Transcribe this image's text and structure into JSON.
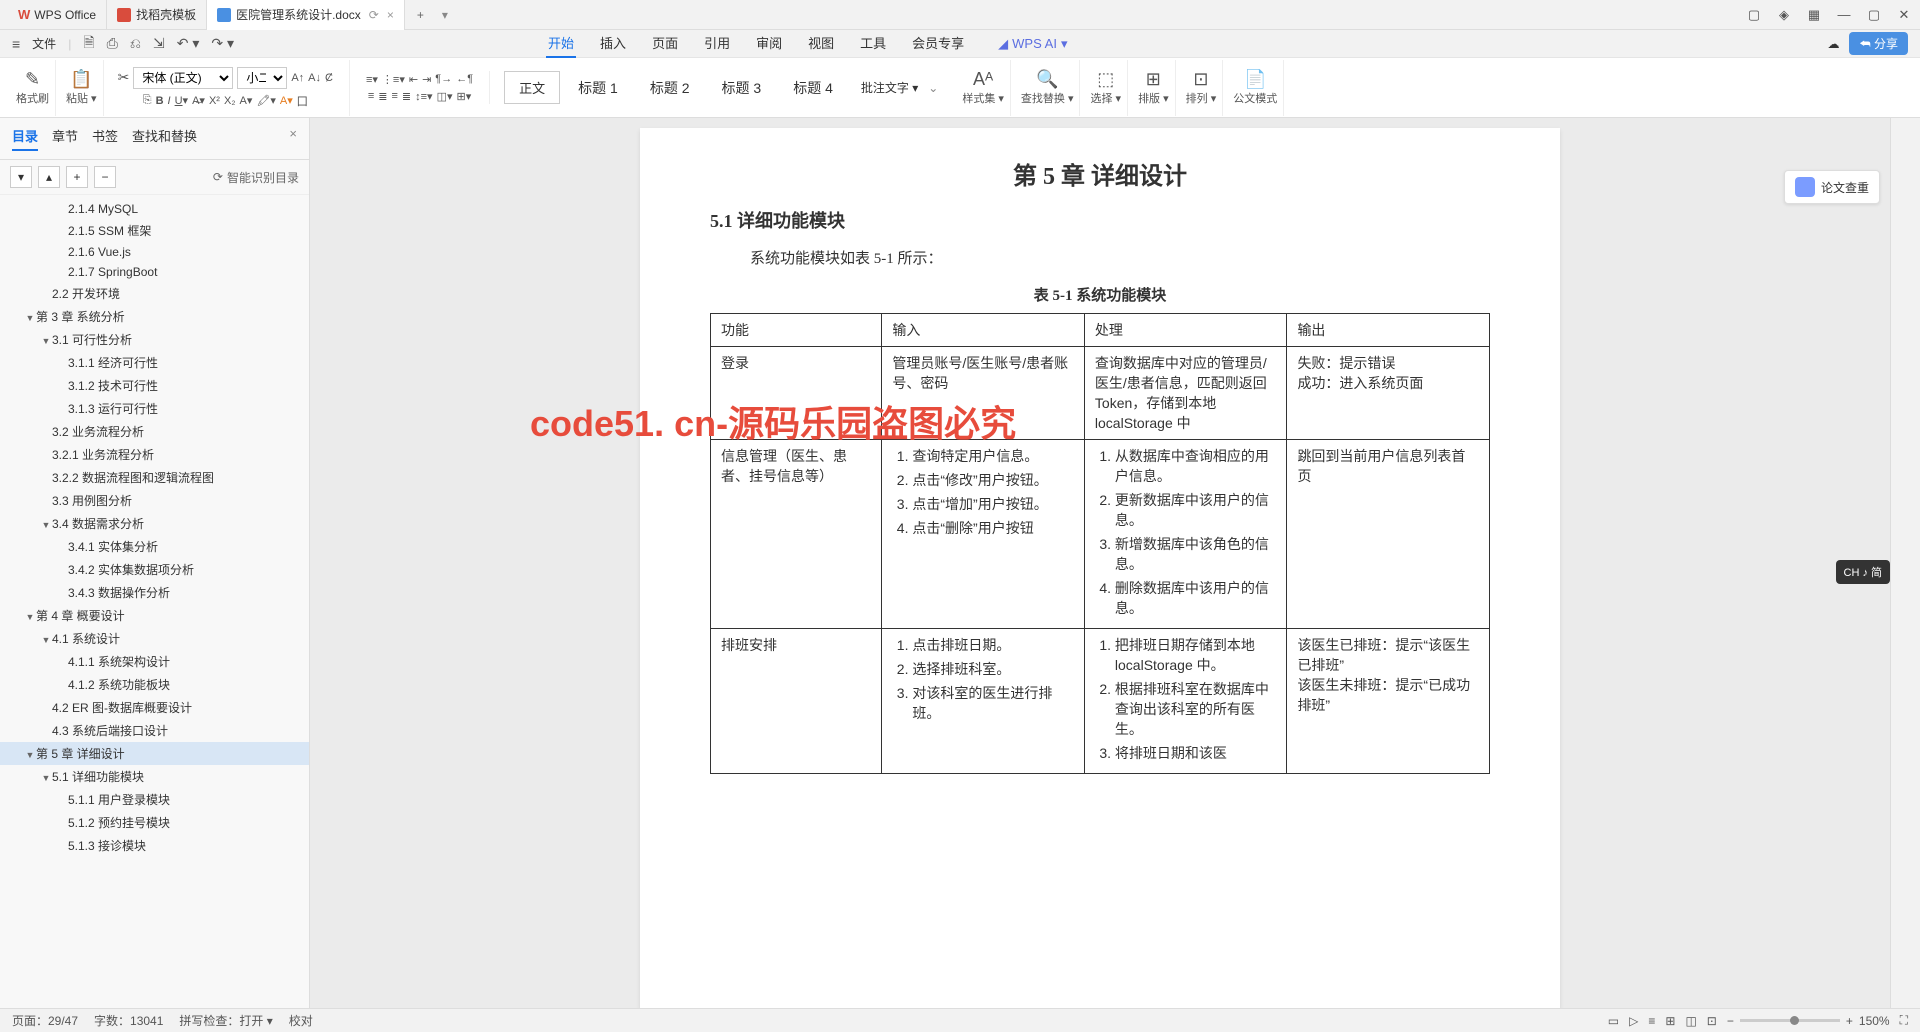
{
  "app": {
    "name": "WPS Office"
  },
  "tabs": [
    {
      "label": "找稻壳模板",
      "color": "#d94c3d"
    },
    {
      "label": "医院管理系统设计.docx",
      "color": "#4a90e2",
      "active": true
    }
  ],
  "quick": {
    "file": "文件"
  },
  "menu": {
    "items": [
      "开始",
      "插入",
      "页面",
      "引用",
      "审阅",
      "视图",
      "工具",
      "会员专享"
    ],
    "active": 0,
    "ai": "WPS AI"
  },
  "share": "分享",
  "ribbon": {
    "format_painter": "格式刷",
    "paste": "粘贴 ▾",
    "font_name": "宋体 (正文)",
    "font_size": "小二",
    "styles": {
      "body": "正文",
      "h1": "标题 1",
      "h2": "标题 2",
      "h3": "标题 3",
      "h4": "标题 4"
    },
    "approve": "批注文字 ▾",
    "style_set": "样式集 ▾",
    "find_replace": "查找替换 ▾",
    "select": "选择 ▾",
    "layout": "排版 ▾",
    "align": "排列 ▾",
    "doc_mode": "公文模式"
  },
  "sidebar": {
    "tabs": [
      "目录",
      "章节",
      "书签",
      "查找和替换"
    ],
    "active": 0,
    "smart_toc": "智能识别目录",
    "items": [
      {
        "indent": 3,
        "label": "2.1.4 MySQL"
      },
      {
        "indent": 3,
        "label": "2.1.5 SSM 框架"
      },
      {
        "indent": 3,
        "label": "2.1.6 Vue.js"
      },
      {
        "indent": 3,
        "label": "2.1.7 SpringBoot"
      },
      {
        "indent": 2,
        "label": "2.2 开发环境"
      },
      {
        "indent": 1,
        "label": "第 3 章  系统分析",
        "arrow": "▼"
      },
      {
        "indent": 2,
        "label": "3.1 可行性分析",
        "arrow": "▼"
      },
      {
        "indent": 3,
        "label": "3.1.1 经济可行性"
      },
      {
        "indent": 3,
        "label": "3.1.2 技术可行性"
      },
      {
        "indent": 3,
        "label": "3.1.3 运行可行性"
      },
      {
        "indent": 2,
        "label": "3.2 业务流程分析"
      },
      {
        "indent": 2,
        "label": "3.2.1 业务流程分析"
      },
      {
        "indent": 2,
        "label": "3.2.2 数据流程图和逻辑流程图"
      },
      {
        "indent": 2,
        "label": "3.3 用例图分析"
      },
      {
        "indent": 2,
        "label": "3.4 数据需求分析",
        "arrow": "▼"
      },
      {
        "indent": 3,
        "label": "3.4.1 实体集分析"
      },
      {
        "indent": 3,
        "label": "3.4.2 实体集数据项分析"
      },
      {
        "indent": 3,
        "label": "3.4.3 数据操作分析"
      },
      {
        "indent": 1,
        "label": "第 4 章 概要设计",
        "arrow": "▼"
      },
      {
        "indent": 2,
        "label": "4.1 系统设计",
        "arrow": "▼"
      },
      {
        "indent": 3,
        "label": "4.1.1 系统架构设计"
      },
      {
        "indent": 3,
        "label": "4.1.2 系统功能板块"
      },
      {
        "indent": 2,
        "label": "4.2 ER 图-数据库概要设计"
      },
      {
        "indent": 2,
        "label": "4.3 系统后端接口设计"
      },
      {
        "indent": 1,
        "label": "第 5 章  详细设计",
        "arrow": "▼",
        "selected": true
      },
      {
        "indent": 2,
        "label": "5.1 详细功能模块",
        "arrow": "▼"
      },
      {
        "indent": 3,
        "label": "5.1.1 用户登录模块"
      },
      {
        "indent": 3,
        "label": "5.1.2 预约挂号模块"
      },
      {
        "indent": 3,
        "label": "5.1.3 接诊模块"
      }
    ]
  },
  "doc": {
    "chapter": "第 5 章   详细设计",
    "section": "5.1  详细功能模块",
    "intro": "系统功能模块如表 5-1 所示：",
    "table_caption": "表 5-1  系统功能模块",
    "th": {
      "c1": "功能",
      "c2": "输入",
      "c3": "处理",
      "c4": "输出"
    },
    "rows": [
      {
        "func": "登录",
        "input": "管理员账号/医生账号/患者账号、密码",
        "proc": "查询数据库中对应的管理员/医生/患者信息，匹配则返回 Token，存储到本地 localStorage 中",
        "out": "失败：提示错误\n成功：进入系统页面"
      },
      {
        "func": "信息管理（医生、患者、挂号信息等）",
        "input_list": [
          "查询特定用户信息。",
          "点击“修改”用户按钮。",
          "点击“增加”用户按钮。",
          "点击“删除”用户按钮"
        ],
        "proc_list": [
          "从数据库中查询相应的用户信息。",
          "更新数据库中该用户的信息。",
          "新增数据库中该角色的信息。",
          "删除数据库中该用户的信息。"
        ],
        "out": "跳回到当前用户信息列表首页"
      },
      {
        "func": "排班安排",
        "input_list": [
          "点击排班日期。",
          "选择排班科室。",
          "对该科室的医生进行排班。"
        ],
        "proc_list": [
          "把排班日期存储到本地 localStorage 中。",
          "根据排班科室在数据库中查询出该科室的所有医生。",
          "将排班日期和该医"
        ],
        "out": "该医生已排班：提示“该医生已排班”\n该医生未排班：提示“已成功排班”"
      }
    ]
  },
  "check_btn": "论文查重",
  "status": {
    "page": "页面：29/47",
    "words": "字数：13041",
    "spell": "拼写检查：打开 ▾",
    "proof": "校对",
    "zoom_label": "150%"
  },
  "ime": "CH ♪ 简",
  "watermark_text": "code51.cn",
  "watermark_red_text": "code51. cn-源码乐园盗图必究"
}
